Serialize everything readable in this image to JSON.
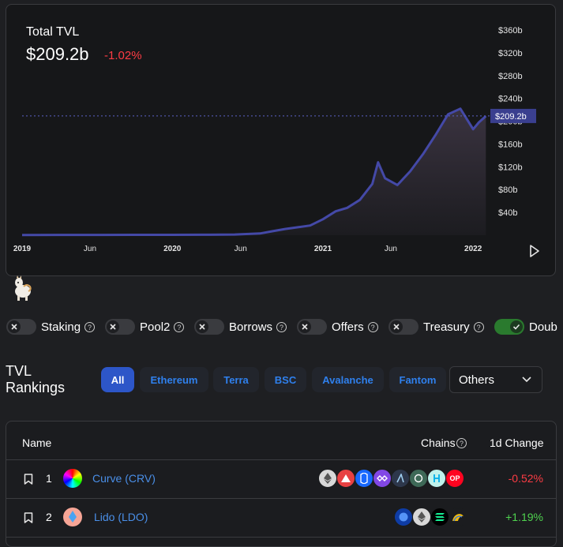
{
  "header": {
    "title": "Total TVL",
    "value": "$209.2b",
    "change": "-1.02%"
  },
  "chart_data": {
    "type": "area",
    "title": "Total TVL",
    "x_ticks": [
      "2019",
      "Jun",
      "2020",
      "Jun",
      "2021",
      "Jun",
      "2022"
    ],
    "y_ticks": [
      "$40b",
      "$80b",
      "$120b",
      "$160b",
      "$200b",
      "$240b",
      "$280b",
      "$320b",
      "$360b"
    ],
    "ylim": [
      0,
      360
    ],
    "current_marker": "$209.2b",
    "current_value": 209.2,
    "series": [
      {
        "x": [
          "2019-01",
          "2019-04",
          "2019-07",
          "2019-10",
          "2020-01",
          "2020-04",
          "2020-06",
          "2020-08",
          "2020-09",
          "2020-10",
          "2020-11",
          "2020-12",
          "2021-01",
          "2021-02",
          "2021-03",
          "2021-04",
          "2021-05",
          "2021-05-15",
          "2021-06",
          "2021-07",
          "2021-08",
          "2021-09",
          "2021-10",
          "2021-11",
          "2021-12",
          "2022-01",
          "2022-01-15",
          "2022-02"
        ],
        "y": [
          0.3,
          0.5,
          0.6,
          0.7,
          0.7,
          0.9,
          1.2,
          3,
          7,
          11,
          14,
          17,
          28,
          42,
          48,
          62,
          90,
          128,
          100,
          88,
          112,
          142,
          175,
          212,
          222,
          186,
          198,
          209
        ]
      }
    ]
  },
  "toggles": [
    {
      "label": "Staking",
      "on": false
    },
    {
      "label": "Pool2",
      "on": false
    },
    {
      "label": "Borrows",
      "on": false
    },
    {
      "label": "Offers",
      "on": false
    },
    {
      "label": "Treasury",
      "on": false
    },
    {
      "label": "Doub",
      "on": true
    }
  ],
  "rankings": {
    "title_line1": "TVL",
    "title_line2": "Rankings",
    "tabs": [
      "All",
      "Ethereum",
      "Terra",
      "BSC",
      "Avalanche",
      "Fantom"
    ],
    "dropdown": "Others"
  },
  "table": {
    "headers": {
      "name": "Name",
      "chains": "Chains",
      "change": "1d Change"
    },
    "rows": [
      {
        "rank": "1",
        "name": "Curve (CRV)",
        "change": "-0.52%"
      },
      {
        "rank": "2",
        "name": "Lido (LDO)",
        "change": "+1.19%"
      }
    ],
    "chain_icons_row1": [
      "ethereum-icon",
      "avalanche-icon",
      "fantom-icon",
      "polygon-icon",
      "arbitrum-icon",
      "xdai-icon",
      "harmony-icon",
      "optimism-icon"
    ],
    "chain_icons_row2": [
      "terra-icon",
      "ethereum-icon",
      "solana-icon",
      "kusama-icon"
    ],
    "optimism_label": "OP"
  },
  "colors": {
    "accent": "#2d56c8",
    "line": "#4449a7",
    "negative": "#fd3c44",
    "positive": "#4fd34f"
  }
}
